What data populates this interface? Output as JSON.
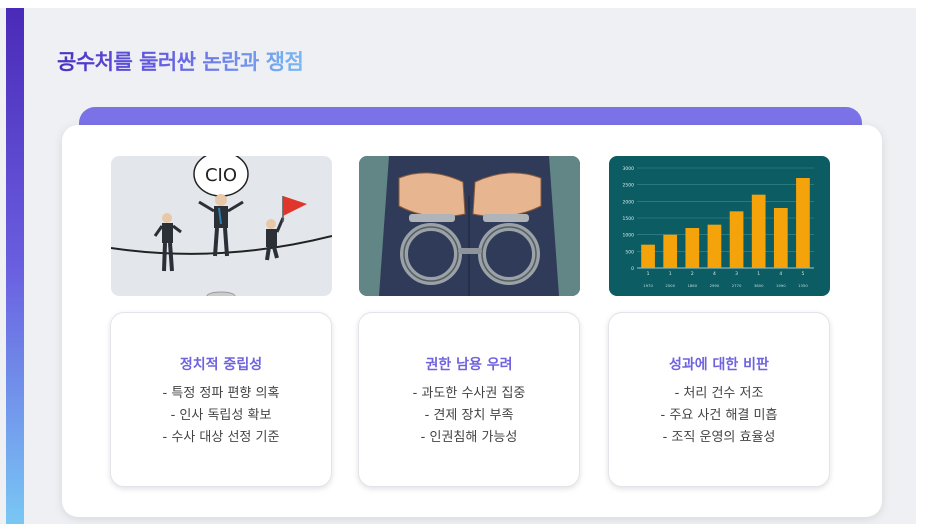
{
  "slide": {
    "title": "공수처를 둘러싼 논란과 쟁점"
  },
  "illustrations": [
    {
      "icon": "cio-tightrope-illustration",
      "sign_text": "CIO"
    },
    {
      "icon": "handcuffed-hands-illustration"
    },
    {
      "icon": "bar-chart-illustration",
      "chart_data": {
        "type": "bar",
        "values": [
          700,
          1000,
          1200,
          1300,
          1700,
          2200,
          1800,
          2700
        ],
        "y_ticks": [
          "0",
          "500",
          "1000",
          "1500",
          "2000",
          "2500",
          "3000"
        ],
        "x_labels": [
          "1",
          "1",
          "2",
          "4",
          "3",
          "1",
          "4",
          "5"
        ],
        "x_sublabels": [
          "1970",
          "2500",
          "1860",
          "2990",
          "2770",
          "3800",
          "1990",
          "1350"
        ],
        "ylim": [
          0,
          3000
        ],
        "bar_color": "#f4a30a"
      }
    }
  ],
  "cards": [
    {
      "title": "정치적 중립성",
      "items": [
        "- 특정 정파 편향 의혹",
        "- 인사 독립성 확보",
        "- 수사 대상 선정 기준"
      ]
    },
    {
      "title": "권한 남용 우려",
      "items": [
        "- 과도한 수사권 집중",
        "- 견제 장치 부족",
        "- 인권침해 가능성"
      ]
    },
    {
      "title": "성과에 대한 비판",
      "items": [
        "- 처리 건수 저조",
        "- 주요 사건 해결 미흡",
        "- 조직 운영의 효율성"
      ]
    }
  ],
  "colors": {
    "accent": "#7b72e8",
    "card_title": "#6f63df",
    "chart_bg": "#0b5c63"
  }
}
